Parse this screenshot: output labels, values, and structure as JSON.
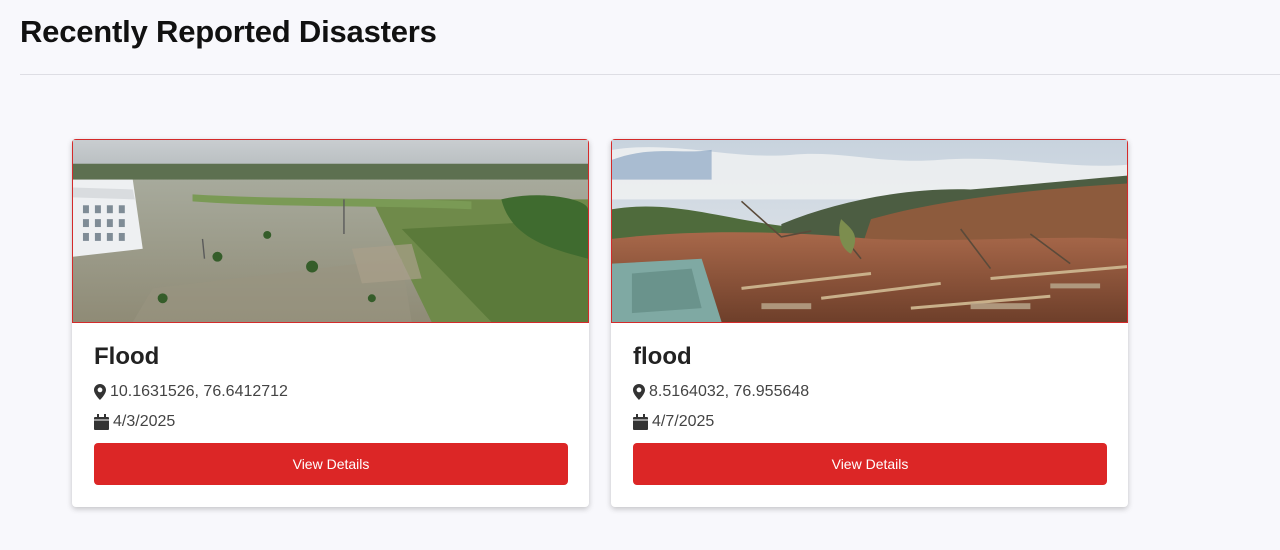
{
  "page": {
    "title": "Recently Reported Disasters"
  },
  "theme": {
    "accent": "#dc2626",
    "background": "#f8f8fc",
    "card_border": "#d42a2a"
  },
  "disasters": [
    {
      "type": "Flood",
      "coordinates": "10.1631526, 76.6412712",
      "date": "4/3/2025",
      "button_label": "View Details",
      "image": "flooded-town-aerial-photo",
      "location_icon": "map-marker-icon",
      "date_icon": "calendar-icon"
    },
    {
      "type": "flood",
      "coordinates": "8.5164032, 76.955648",
      "date": "4/7/2025",
      "button_label": "View Details",
      "image": "landslide-debris-photo",
      "location_icon": "map-marker-icon",
      "date_icon": "calendar-icon"
    }
  ]
}
